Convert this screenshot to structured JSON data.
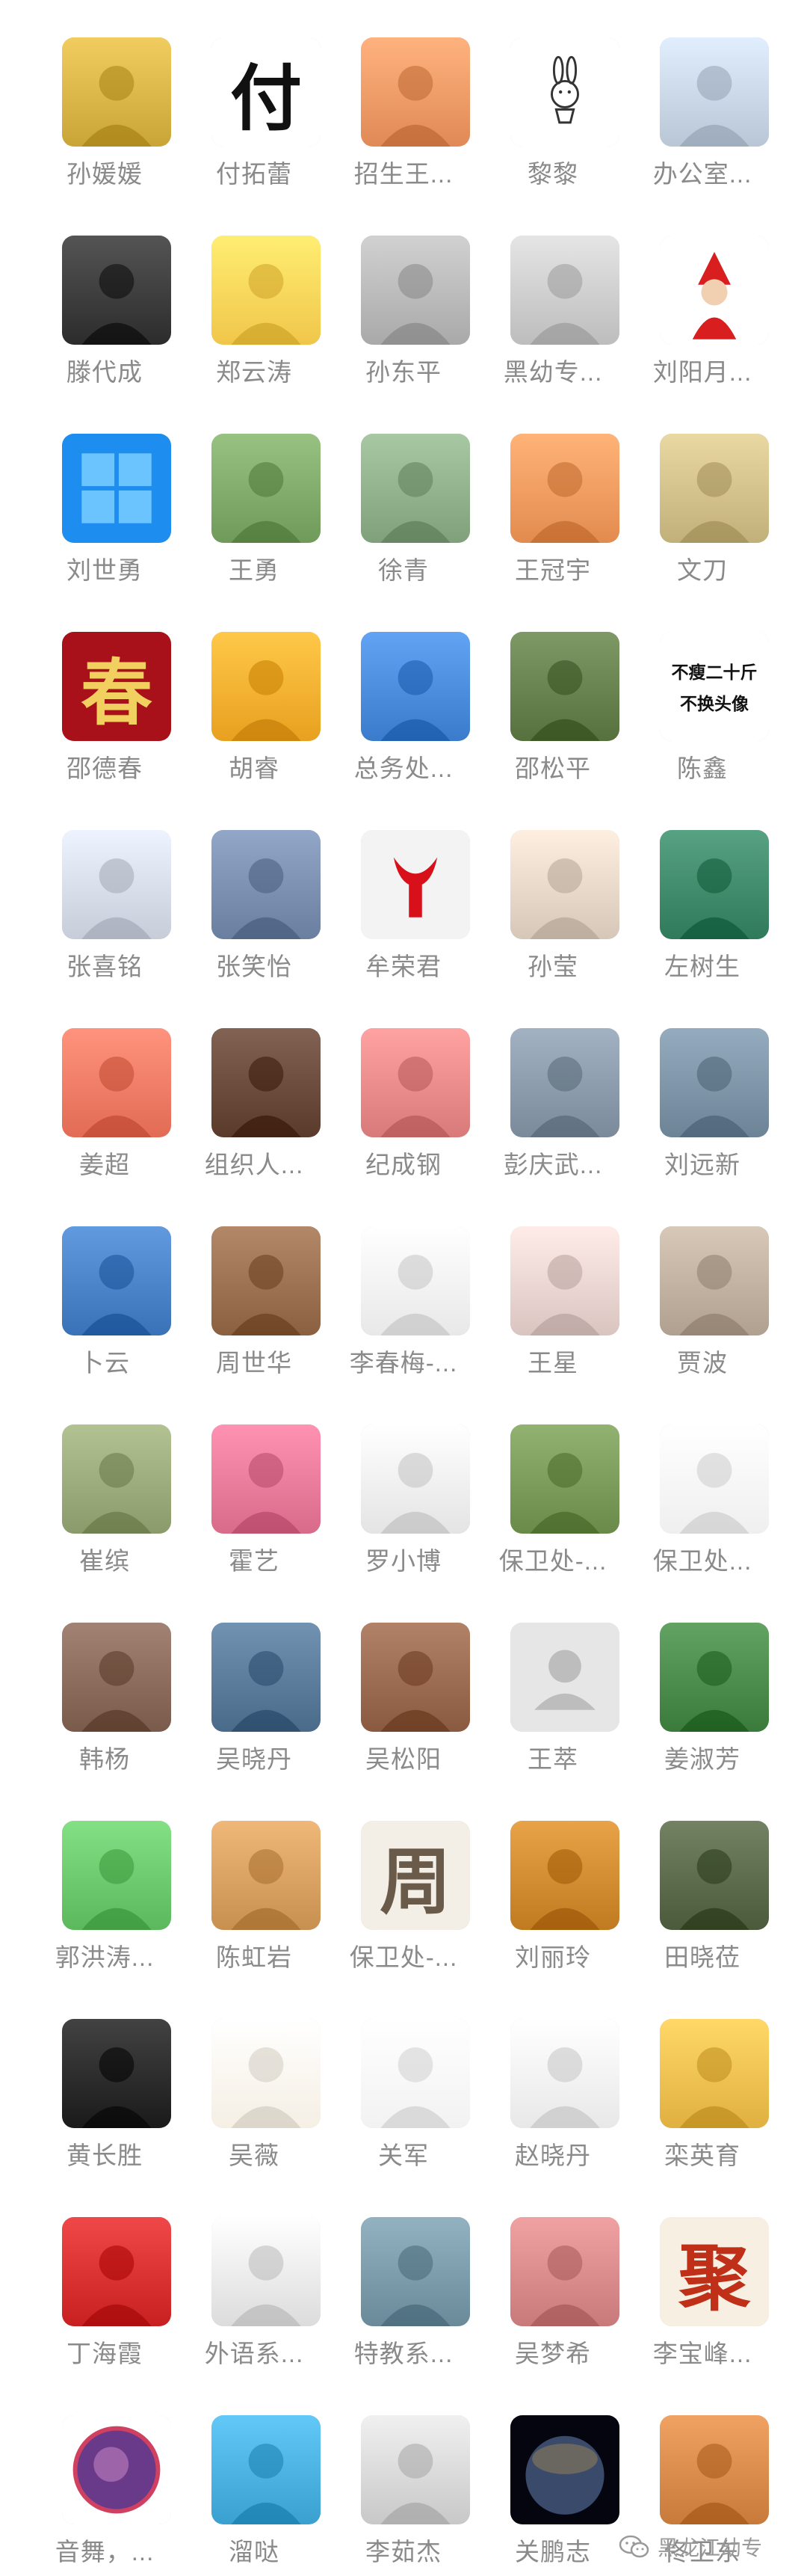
{
  "contacts": [
    {
      "name": "孙媛媛",
      "avatar": "flower-hand",
      "bg": "#c9a437"
    },
    {
      "name": "付拓蕾",
      "avatar": "calligraphy-fu",
      "bg": "#ffffff",
      "text": "付"
    },
    {
      "name": "招生王...",
      "avatar": "cartoon-sunglasses",
      "bg": "#e08a56"
    },
    {
      "name": "黎黎",
      "avatar": "rabbit-sketch",
      "bg": "#ffffff"
    },
    {
      "name": "办公室...",
      "avatar": "lake-tree",
      "bg": "#b8c6d6"
    },
    {
      "name": "滕代成",
      "avatar": "dark-bottle",
      "bg": "#2c2c2c"
    },
    {
      "name": "郑云涛",
      "avatar": "cartoon-girl-mask",
      "bg": "#f0c64a"
    },
    {
      "name": "孙东平",
      "avatar": "cartoon-boy-window",
      "bg": "#a9a9a9"
    },
    {
      "name": "黑幼专...",
      "avatar": "portrait-bw",
      "bg": "#bdbdbd"
    },
    {
      "name": "刘阳月...",
      "avatar": "red-figure",
      "bg": "#ffffff"
    },
    {
      "name": "刘世勇",
      "avatar": "windows-logo",
      "bg": "#1e8df0"
    },
    {
      "name": "王勇",
      "avatar": "green-valley",
      "bg": "#6f9a5a"
    },
    {
      "name": "徐青",
      "avatar": "mountains",
      "bg": "#7fa07a"
    },
    {
      "name": "王冠宇",
      "avatar": "child-photo",
      "bg": "#e38b4f"
    },
    {
      "name": "文刀",
      "avatar": "boy-classroom",
      "bg": "#c2b07a"
    },
    {
      "name": "邵德春",
      "avatar": "red-calligraphy",
      "bg": "#a8101a",
      "text": "春"
    },
    {
      "name": "胡睿",
      "avatar": "autumn-road",
      "bg": "#e8a020"
    },
    {
      "name": "总务处...",
      "avatar": "road-blue-sky",
      "bg": "#3b7bcc"
    },
    {
      "name": "邵松平",
      "avatar": "river-grassland",
      "bg": "#56703e"
    },
    {
      "name": "陈鑫",
      "avatar": "text-avatar",
      "bg": "#ffffff",
      "text1": "不瘦二十斤",
      "text2": "不换头像"
    },
    {
      "name": "张喜铭",
      "avatar": "calligraphy-class",
      "bg": "#c6ccd8"
    },
    {
      "name": "张笑怡",
      "avatar": "sunset-hills",
      "bg": "#6a7fa0"
    },
    {
      "name": "牟荣君",
      "avatar": "red-bull-head",
      "bg": "#f3f3f3"
    },
    {
      "name": "孙莹",
      "avatar": "woman-hat",
      "bg": "#d6c7b8"
    },
    {
      "name": "左树生",
      "avatar": "green-waterfall",
      "bg": "#2f7a5a"
    },
    {
      "name": "姜超",
      "avatar": "mother-child",
      "bg": "#e26b55"
    },
    {
      "name": "组织人...",
      "avatar": "panda-grid",
      "bg": "#5a3a2a"
    },
    {
      "name": "纪成钢",
      "avatar": "pig-cartoon",
      "bg": "#d87a7a"
    },
    {
      "name": "彭庆武...",
      "avatar": "man-suit",
      "bg": "#7a8a9a"
    },
    {
      "name": "刘远新",
      "avatar": "lake-gray",
      "bg": "#6d8396"
    },
    {
      "name": "卜云",
      "avatar": "lake-blue",
      "bg": "#3a72b8"
    },
    {
      "name": "周世华",
      "avatar": "chinese-room",
      "bg": "#8a6040"
    },
    {
      "name": "李春梅-...",
      "avatar": "flower-vase-flag",
      "bg": "#e8e8e8"
    },
    {
      "name": "王星",
      "avatar": "woman-portrait",
      "bg": "#d9c4c0"
    },
    {
      "name": "贾波",
      "avatar": "cartoon-couple",
      "bg": "#b0a090"
    },
    {
      "name": "崔缤",
      "avatar": "man-sunglasses",
      "bg": "#8a9a6a"
    },
    {
      "name": "霍艺",
      "avatar": "pink-blossom",
      "bg": "#d86a8a"
    },
    {
      "name": "罗小博",
      "avatar": "ink-painting",
      "bg": "#e4e4e4"
    },
    {
      "name": "保卫处-...",
      "avatar": "painted-girl",
      "bg": "#6a8a4a"
    },
    {
      "name": "保卫处...",
      "avatar": "red-robe-figure",
      "bg": "#efefef"
    },
    {
      "name": "韩杨",
      "avatar": "sculpture-brown",
      "bg": "#7a5a4a"
    },
    {
      "name": "吴晓丹",
      "avatar": "bull-statue",
      "bg": "#4a6a8a"
    },
    {
      "name": "吴松阳",
      "avatar": "lotus",
      "bg": "#8a5a40"
    },
    {
      "name": "王萃",
      "avatar": "default-person",
      "bg": "#e6e6e6"
    },
    {
      "name": "姜淑芳",
      "avatar": "red-flowers",
      "bg": "#3a7a3a"
    },
    {
      "name": "郭洪涛...",
      "avatar": "cartoon-glasses-man",
      "bg": "#5cb85c"
    },
    {
      "name": "陈虹岩",
      "avatar": "savanna",
      "bg": "#c89050"
    },
    {
      "name": "保卫处-...",
      "avatar": "zhou-calligraphy",
      "bg": "#f4efe6",
      "text": "周"
    },
    {
      "name": "刘丽玲",
      "avatar": "sunset-river",
      "bg": "#c07a20"
    },
    {
      "name": "田晓莅",
      "avatar": "family-photo",
      "bg": "#4a5a3a"
    },
    {
      "name": "黄长胜",
      "avatar": "red-ox-art",
      "bg": "#1a1a1a"
    },
    {
      "name": "吴薇",
      "avatar": "girl-sketch",
      "bg": "#f5efe4"
    },
    {
      "name": "关军",
      "avatar": "girl-sunglasses",
      "bg": "#f2f2f2"
    },
    {
      "name": "赵晓丹",
      "avatar": "anime-bw",
      "bg": "#e8e8e8"
    },
    {
      "name": "栾英育",
      "avatar": "boy-yellow",
      "bg": "#e0b040"
    },
    {
      "name": "丁海霞",
      "avatar": "red-koi",
      "bg": "#c82020"
    },
    {
      "name": "外语系...",
      "avatar": "soldier-sketch",
      "bg": "#dcdcdc"
    },
    {
      "name": "特教系...",
      "avatar": "campus",
      "bg": "#6a8a9a"
    },
    {
      "name": "吴梦希",
      "avatar": "woman-smile",
      "bg": "#c87a7a"
    },
    {
      "name": "李宝峰...",
      "avatar": "ju-calligraphy",
      "bg": "#f6efe2",
      "text": "聚"
    },
    {
      "name": "音舞，...",
      "avatar": "purple-circle",
      "bg": "#ffffff"
    },
    {
      "name": "溜哒",
      "avatar": "beach-palm",
      "bg": "#3aa0d0"
    },
    {
      "name": "李茹杰",
      "avatar": "woman-flag",
      "bg": "#c8c8c8"
    },
    {
      "name": "关鹏志",
      "avatar": "planet",
      "bg": "#0a0a1a"
    },
    {
      "name": "佟卫东",
      "avatar": "canyon",
      "bg": "#c87a3a"
    }
  ],
  "watermark": {
    "text": "黑龙江幼专"
  }
}
